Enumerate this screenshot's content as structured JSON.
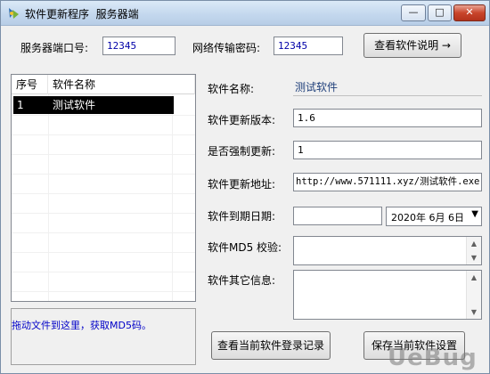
{
  "window": {
    "title": "软件更新程序  服务器端",
    "minimize_glyph": "—",
    "maximize_glyph": "□",
    "close_glyph": "✕"
  },
  "top": {
    "port_label": "服务器端口号:",
    "port_value": "12345",
    "password_label": "网络传输密码:",
    "password_value": "12345",
    "view_manual_button": "查看软件说明 →"
  },
  "software_list": {
    "columns": [
      "序号",
      "软件名称"
    ],
    "rows": [
      {
        "index": "1",
        "name": "测试软件",
        "selected": true
      }
    ]
  },
  "drop_hint": "拖动文件到这里，获取MD5码。",
  "form": {
    "name_label": "软件名称:",
    "name_value": "测试软件",
    "version_label": "软件更新版本:",
    "version_value": "1.6",
    "force_label": "是否强制更新:",
    "force_value": "1",
    "url_label": "软件更新地址:",
    "url_value": "http://www.571111.xyz/测试软件.exe",
    "expire_label": "软件到期日期:",
    "expire_text_value": "",
    "expire_date_value": "2020年 6月 6日",
    "md5_label": "软件MD5 校验:",
    "md5_value": "",
    "other_label": "软件其它信息:",
    "other_value": ""
  },
  "buttons": {
    "view_login_records": "查看当前软件登录记录",
    "save_settings": "保存当前软件设置"
  },
  "watermark": "UeBug",
  "colors": {
    "title_bar": "#c4d8ee",
    "selected_row_bg": "#000000",
    "drop_hint_text": "#0000c8",
    "software_name_text": "#1f3f7a",
    "close_button": "#c9452b"
  },
  "icons": {
    "app": "app-icon",
    "scroll_up": "scroll-up-icon",
    "scroll_down": "scroll-down-icon",
    "dropdown": "chevron-down-icon"
  }
}
